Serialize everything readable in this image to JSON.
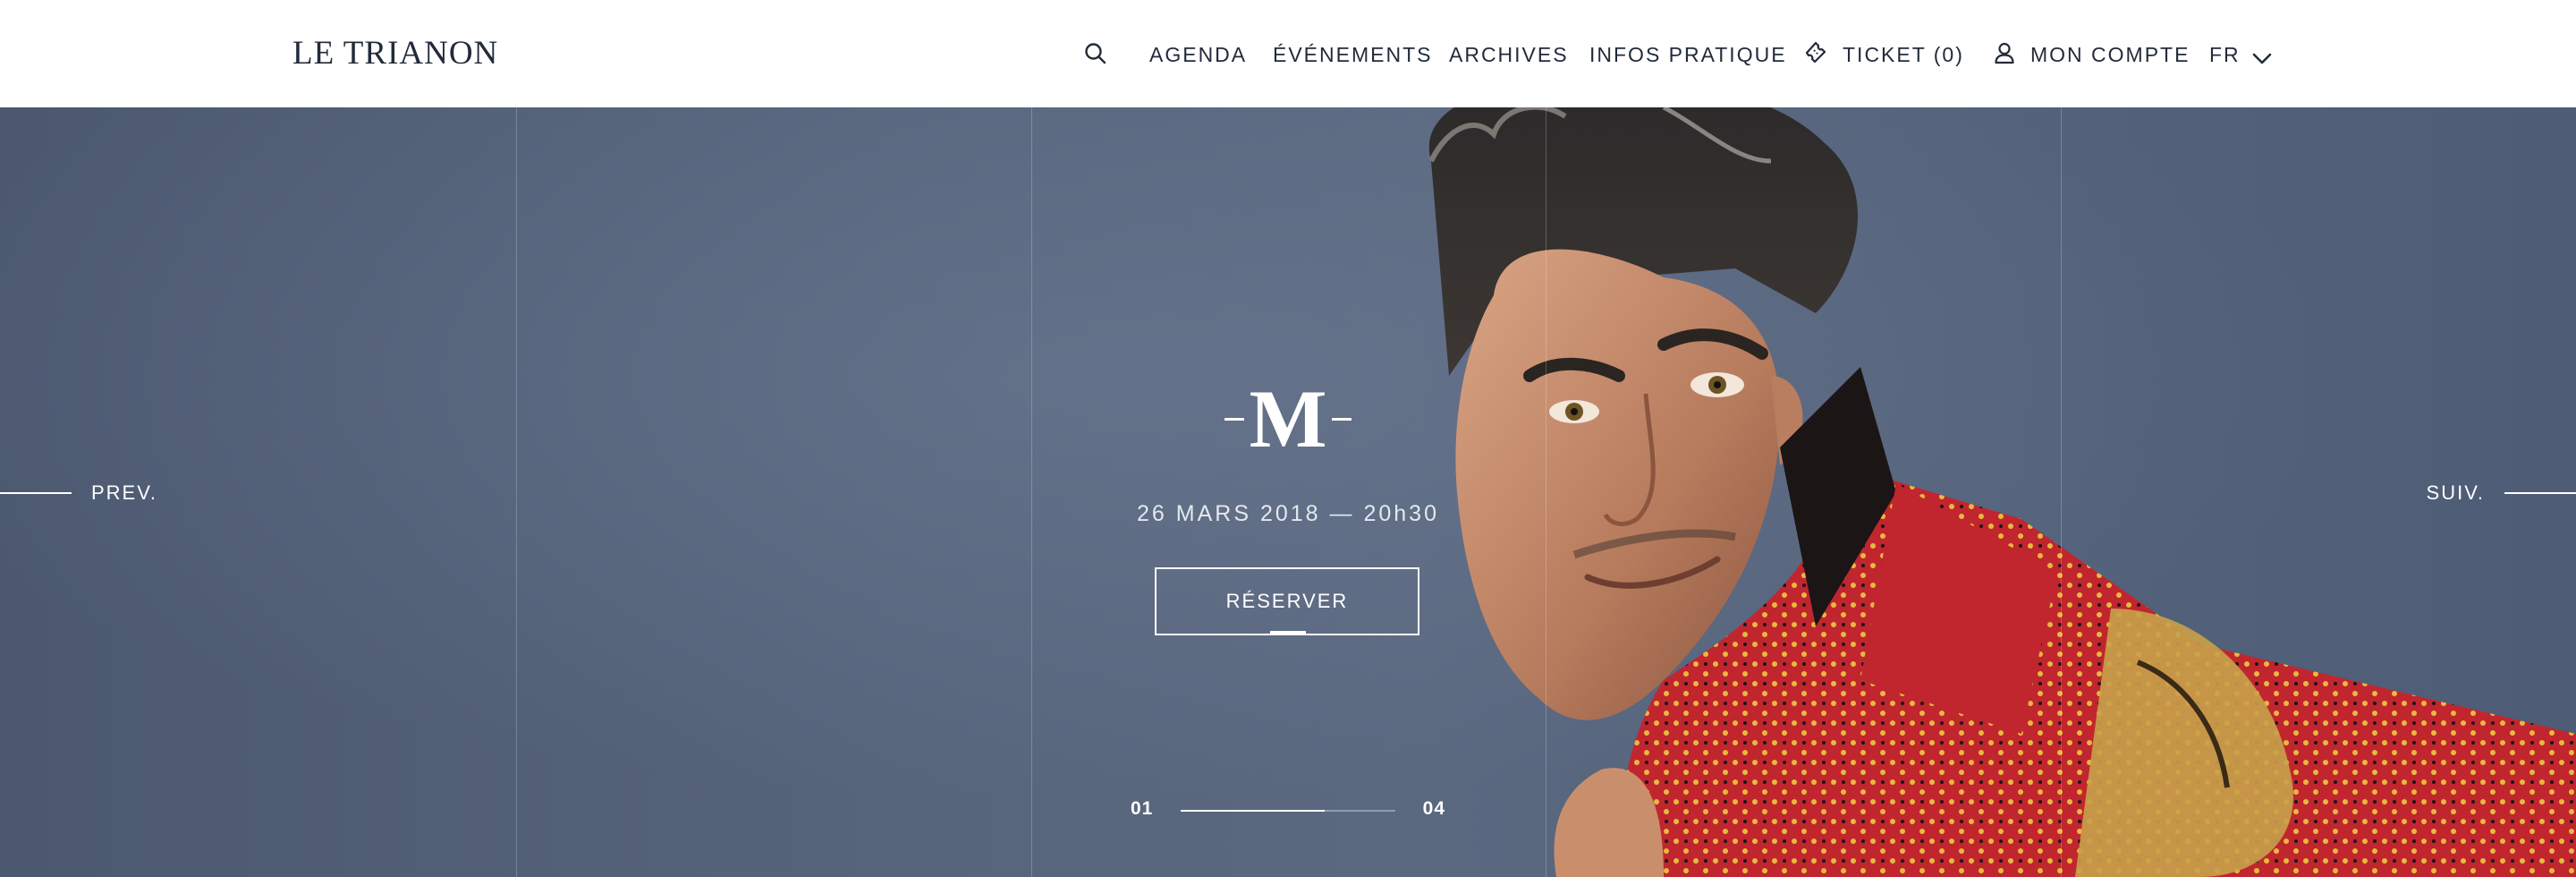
{
  "brand": {
    "logo": "LE TRIANON"
  },
  "nav": {
    "agenda": "AGENDA",
    "evenements": "ÉVÉNEMENTS",
    "archives": "ARCHIVES",
    "infos": "INFOS PRATIQUE",
    "ticket": "TICKET (0)",
    "account": "MON COMPTE",
    "language": "FR"
  },
  "hero": {
    "title": "M",
    "date": "26 MARS 2018 — 20h30",
    "cta": "RÉSERVER",
    "prev": "PREV.",
    "next": "SUIV.",
    "pager": {
      "current": "01",
      "total": "04",
      "progress": 0.67
    }
  },
  "icons": [
    "search-icon",
    "ticket-icon",
    "user-icon",
    "chevron-down-icon"
  ],
  "colors": {
    "header_bg": "#ffffff",
    "text_dark": "#222b3a",
    "hero_bg": "#4e5d76",
    "accent_red": "#c1262e"
  }
}
